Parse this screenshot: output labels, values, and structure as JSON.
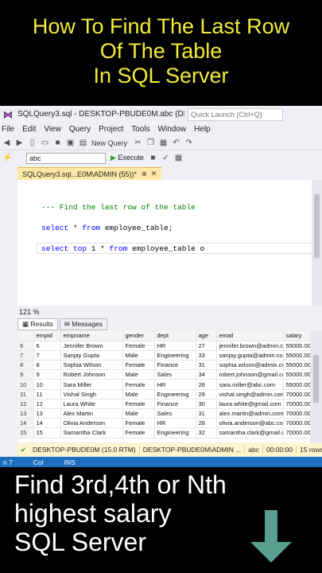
{
  "top_banner": {
    "line1": "How To Find The Last Row",
    "line2": "Of The Table",
    "line3": "In SQL Server"
  },
  "window": {
    "title": "SQLQuery3.sql - DESKTOP-PBUDE0M.abc (DE...",
    "quick_launch_placeholder": "Quick Launch (Ctrl+Q)"
  },
  "menu": {
    "file": "File",
    "edit": "Edit",
    "view": "View",
    "query": "Query",
    "project": "Project",
    "tools": "Tools",
    "window": "Window",
    "help": "Help"
  },
  "toolbar": {
    "new_query": "New Query",
    "database": "abc",
    "execute": "Execute"
  },
  "doc_tab": {
    "label": "SQLQuery3.sql...E0M\\ADMIN (55))*",
    "pin": "⊕",
    "close": "✕"
  },
  "editor": {
    "line1": "--- Find the last row of the table",
    "line2_kw": "select",
    "line2_rest": " * ",
    "line2_kw2": "from",
    "line2_end": " employee_table;",
    "line3_kw": "select top",
    "line3_mid": " 1 * ",
    "line3_kw2": "from",
    "line3_end": " employee_table o"
  },
  "zoom": "121 %",
  "results_tabs": {
    "results": "Results",
    "messages": "Messages"
  },
  "grid": {
    "columns": [
      "",
      "empid",
      "empname",
      "gender",
      "dept",
      "age",
      "email",
      "salary"
    ],
    "rows": [
      [
        "6",
        "6",
        "Jennifer Brown",
        "Female",
        "HR",
        "27",
        "jennifer.brown@admin.com",
        "55000.00"
      ],
      [
        "7",
        "7",
        "Sanjay Gupta",
        "Male",
        "Engineering",
        "33",
        "sanjay.gupta@admin.com",
        "55000.00"
      ],
      [
        "8",
        "8",
        "Sophia Wilson",
        "Female",
        "Finance",
        "31",
        "sophia.wilson@admin.com",
        "55000.00"
      ],
      [
        "9",
        "9",
        "Robert Johnson",
        "Male",
        "Sales",
        "34",
        "robert.johnson@gmail.com",
        "55000.00"
      ],
      [
        "10",
        "10",
        "Sara Miller",
        "Female",
        "HR",
        "26",
        "sara.miller@abc.com",
        "55000.00"
      ],
      [
        "11",
        "11",
        "Vishal Singh",
        "Male",
        "Engineering",
        "29",
        "vishal.singh@admin.com",
        "70000.00"
      ],
      [
        "12",
        "12",
        "Laura White",
        "Female",
        "Finance",
        "30",
        "laura.white@gmail.com",
        "70000.00"
      ],
      [
        "13",
        "13",
        "Alex Martin",
        "Male",
        "Sales",
        "31",
        "alex.martin@admin.com",
        "70000.00"
      ],
      [
        "14",
        "14",
        "Olivia Anderson",
        "Female",
        "HR",
        "28",
        "olivia.anderson@abc.com",
        "70000.00"
      ],
      [
        "15",
        "15",
        "Samantha Clark",
        "Female",
        "Engineering",
        "32",
        "samantha.clark@gmail.c...",
        "70000.00"
      ]
    ]
  },
  "query_status": {
    "server": "DESKTOP-PBUDE0M (15.0 RTM)",
    "connection": "DESKTOP-PBUDE0M\\ADMIN ...",
    "db": "abc",
    "time": "00:00:00",
    "rows": "15 rows"
  },
  "statusbar": {
    "ln": "n 7",
    "col": "Col",
    "ins": "INS"
  },
  "bottom_banner": {
    "line1": "Find 3rd,4th or Nth",
    "line2": "highest salary",
    "line3": "SQL Server"
  },
  "colors": {
    "accent_yellow": "#f2ec3a",
    "status_blue": "#1e6fbf",
    "arrow": "#5a9e8c"
  }
}
